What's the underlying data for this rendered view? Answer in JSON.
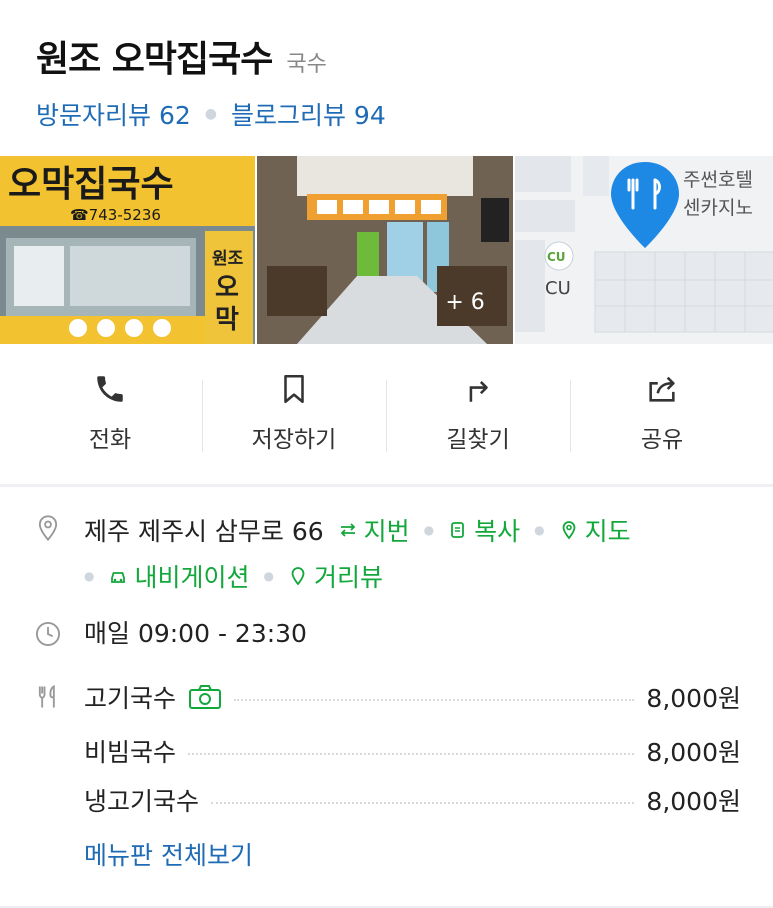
{
  "place": {
    "name": "원조 오막집국수",
    "category": "국수",
    "visitor_reviews": "방문자리뷰 62",
    "blog_reviews": "블로그리뷰 94"
  },
  "photos": {
    "storefront_sign_text": "오막집국수",
    "storefront_phone": "☎743-5236",
    "more_count": "+ 6",
    "map_labels": [
      "CU",
      "CU",
      "주썬호텔",
      "센카지노"
    ]
  },
  "actions": [
    {
      "label": "전화",
      "icon": "phone-icon"
    },
    {
      "label": "저장하기",
      "icon": "bookmark-icon"
    },
    {
      "label": "길찾기",
      "icon": "directions-icon"
    },
    {
      "label": "공유",
      "icon": "share-icon"
    }
  ],
  "info": {
    "address": "제주 제주시 삼무로 66",
    "address_links": {
      "lot_number": "지번",
      "copy": "복사",
      "map": "지도",
      "navigation": "내비게이션",
      "street_view": "거리뷰"
    },
    "hours": "매일 09:00 - 23:30",
    "menu": [
      {
        "name": "고기국수",
        "price": "8,000원",
        "has_photo": true
      },
      {
        "name": "비빔국수",
        "price": "8,000원",
        "has_photo": false
      },
      {
        "name": "냉고기국수",
        "price": "8,000원",
        "has_photo": false
      }
    ],
    "menu_all_link": "메뉴판 전체보기"
  },
  "colors": {
    "link_blue": "#1f6bb5",
    "link_green": "#13a83c",
    "map_pin_blue": "#1e88e5"
  }
}
